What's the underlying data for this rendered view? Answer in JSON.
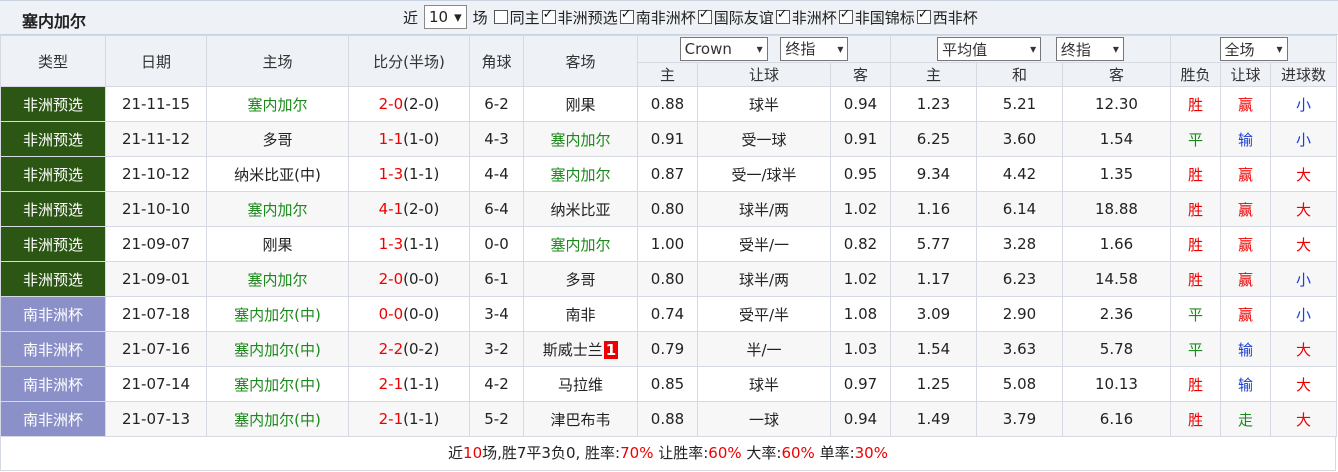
{
  "title": "塞内加尔",
  "filters": {
    "prefix": "近",
    "count": "10",
    "suffix": "场",
    "items": [
      {
        "label": "同主",
        "checked": false
      },
      {
        "label": "非洲预选",
        "checked": true
      },
      {
        "label": "南非洲杯",
        "checked": true
      },
      {
        "label": "国际友谊",
        "checked": true
      },
      {
        "label": "非洲杯",
        "checked": true
      },
      {
        "label": "非国锦标",
        "checked": true
      },
      {
        "label": "西非杯",
        "checked": true
      }
    ]
  },
  "header": {
    "type": "类型",
    "date": "日期",
    "home": "主场",
    "score": "比分(半场)",
    "corner": "角球",
    "away": "客场",
    "company": "Crown",
    "odds_type1": "终指",
    "avg": "平均值",
    "odds_type2": "终指",
    "scope": "全场",
    "sub": {
      "h_home": "主",
      "h_handicap": "让球",
      "h_away": "客",
      "e_home": "主",
      "e_draw": "和",
      "e_away": "客",
      "result": "胜负",
      "hc_result": "让球",
      "goals": "进球数"
    }
  },
  "rows": [
    {
      "type": "非洲预选",
      "cat": "a",
      "date": "21-11-15",
      "home": "塞内加尔",
      "home_hl": true,
      "score": "2-0",
      "half": "(2-0)",
      "corner": "6-2",
      "away": "刚果",
      "away_hl": false,
      "away_tag": "",
      "ah": "0.88",
      "hc": "球半",
      "aa": "0.94",
      "eh": "1.23",
      "ed": "5.21",
      "ea": "12.30",
      "res": "胜",
      "res_c": "red",
      "hcr": "赢",
      "hcr_c": "red",
      "goals": "小",
      "goals_c": "blue"
    },
    {
      "type": "非洲预选",
      "cat": "a",
      "date": "21-11-12",
      "home": "多哥",
      "home_hl": false,
      "score": "1-1",
      "half": "(1-0)",
      "corner": "4-3",
      "away": "塞内加尔",
      "away_hl": true,
      "away_tag": "",
      "ah": "0.91",
      "hc": "受一球",
      "aa": "0.91",
      "eh": "6.25",
      "ed": "3.60",
      "ea": "1.54",
      "res": "平",
      "res_c": "green",
      "hcr": "输",
      "hcr_c": "blue",
      "goals": "小",
      "goals_c": "blue"
    },
    {
      "type": "非洲预选",
      "cat": "a",
      "date": "21-10-12",
      "home": "纳米比亚(中)",
      "home_hl": false,
      "score": "1-3",
      "half": "(1-1)",
      "corner": "4-4",
      "away": "塞内加尔",
      "away_hl": true,
      "away_tag": "",
      "ah": "0.87",
      "hc": "受一/球半",
      "aa": "0.95",
      "eh": "9.34",
      "ed": "4.42",
      "ea": "1.35",
      "res": "胜",
      "res_c": "red",
      "hcr": "赢",
      "hcr_c": "red",
      "goals": "大",
      "goals_c": "red"
    },
    {
      "type": "非洲预选",
      "cat": "a",
      "date": "21-10-10",
      "home": "塞内加尔",
      "home_hl": true,
      "score": "4-1",
      "half": "(2-0)",
      "corner": "6-4",
      "away": "纳米比亚",
      "away_hl": false,
      "away_tag": "",
      "ah": "0.80",
      "hc": "球半/两",
      "aa": "1.02",
      "eh": "1.16",
      "ed": "6.14",
      "ea": "18.88",
      "res": "胜",
      "res_c": "red",
      "hcr": "赢",
      "hcr_c": "red",
      "goals": "大",
      "goals_c": "red"
    },
    {
      "type": "非洲预选",
      "cat": "a",
      "date": "21-09-07",
      "home": "刚果",
      "home_hl": false,
      "score": "1-3",
      "half": "(1-1)",
      "corner": "0-0",
      "away": "塞内加尔",
      "away_hl": true,
      "away_tag": "",
      "ah": "1.00",
      "hc": "受半/一",
      "aa": "0.82",
      "eh": "5.77",
      "ed": "3.28",
      "ea": "1.66",
      "res": "胜",
      "res_c": "red",
      "hcr": "赢",
      "hcr_c": "red",
      "goals": "大",
      "goals_c": "red"
    },
    {
      "type": "非洲预选",
      "cat": "a",
      "date": "21-09-01",
      "home": "塞内加尔",
      "home_hl": true,
      "score": "2-0",
      "half": "(0-0)",
      "corner": "6-1",
      "away": "多哥",
      "away_hl": false,
      "away_tag": "",
      "ah": "0.80",
      "hc": "球半/两",
      "aa": "1.02",
      "eh": "1.17",
      "ed": "6.23",
      "ea": "14.58",
      "res": "胜",
      "res_c": "red",
      "hcr": "赢",
      "hcr_c": "red",
      "goals": "小",
      "goals_c": "blue"
    },
    {
      "type": "南非洲杯",
      "cat": "b",
      "date": "21-07-18",
      "home": "塞内加尔(中)",
      "home_hl": true,
      "score": "0-0",
      "half": "(0-0)",
      "corner": "3-4",
      "away": "南非",
      "away_hl": false,
      "away_tag": "",
      "ah": "0.74",
      "hc": "受平/半",
      "aa": "1.08",
      "eh": "3.09",
      "ed": "2.90",
      "ea": "2.36",
      "res": "平",
      "res_c": "green",
      "hcr": "赢",
      "hcr_c": "red",
      "goals": "小",
      "goals_c": "blue"
    },
    {
      "type": "南非洲杯",
      "cat": "b",
      "date": "21-07-16",
      "home": "塞内加尔(中)",
      "home_hl": true,
      "score": "2-2",
      "half": "(0-2)",
      "corner": "3-2",
      "away": "斯威士兰",
      "away_hl": false,
      "away_tag": "1",
      "ah": "0.79",
      "hc": "半/一",
      "aa": "1.03",
      "eh": "1.54",
      "ed": "3.63",
      "ea": "5.78",
      "res": "平",
      "res_c": "green",
      "hcr": "输",
      "hcr_c": "blue",
      "goals": "大",
      "goals_c": "red"
    },
    {
      "type": "南非洲杯",
      "cat": "b",
      "date": "21-07-14",
      "home": "塞内加尔(中)",
      "home_hl": true,
      "score": "2-1",
      "half": "(1-1)",
      "corner": "4-2",
      "away": "马拉维",
      "away_hl": false,
      "away_tag": "",
      "ah": "0.85",
      "hc": "球半",
      "aa": "0.97",
      "eh": "1.25",
      "ed": "5.08",
      "ea": "10.13",
      "res": "胜",
      "res_c": "red",
      "hcr": "输",
      "hcr_c": "blue",
      "goals": "大",
      "goals_c": "red"
    },
    {
      "type": "南非洲杯",
      "cat": "b",
      "date": "21-07-13",
      "home": "塞内加尔(中)",
      "home_hl": true,
      "score": "2-1",
      "half": "(1-1)",
      "corner": "5-2",
      "away": "津巴布韦",
      "away_hl": false,
      "away_tag": "",
      "ah": "0.88",
      "hc": "一球",
      "aa": "0.94",
      "eh": "1.49",
      "ed": "3.79",
      "ea": "6.16",
      "res": "胜",
      "res_c": "red",
      "hcr": "走",
      "hcr_c": "green",
      "goals": "大",
      "goals_c": "red"
    }
  ],
  "summary": {
    "p1": "近",
    "n": "10",
    "p2": "场,胜7平3负0, 胜率:",
    "win": "70%",
    "p3": " 让胜率:",
    "hc": "60%",
    "p4": " 大率:",
    "big": "60%",
    "p5": " 单率:",
    "odd": "30%"
  }
}
